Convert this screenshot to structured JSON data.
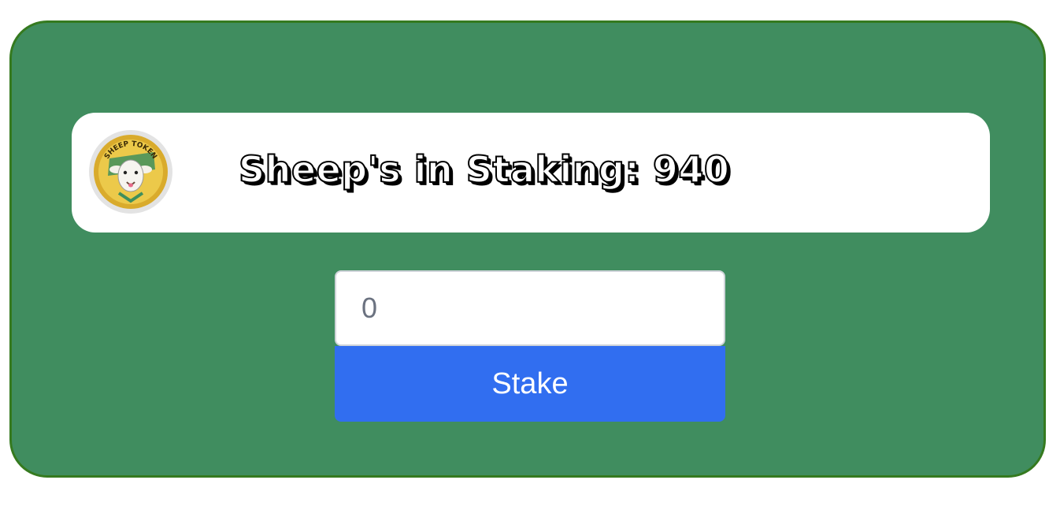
{
  "banner": {
    "logo_icon": "sheep-token-coin-icon",
    "logo_text": "SHEEP TOKEN",
    "title": "Sheep's in Staking: 940"
  },
  "stake_form": {
    "amount_value": "0",
    "stake_label": "Stake"
  },
  "colors": {
    "panel_background": "#408d5f",
    "panel_border": "#357a1f",
    "button_background": "#316ef0"
  }
}
